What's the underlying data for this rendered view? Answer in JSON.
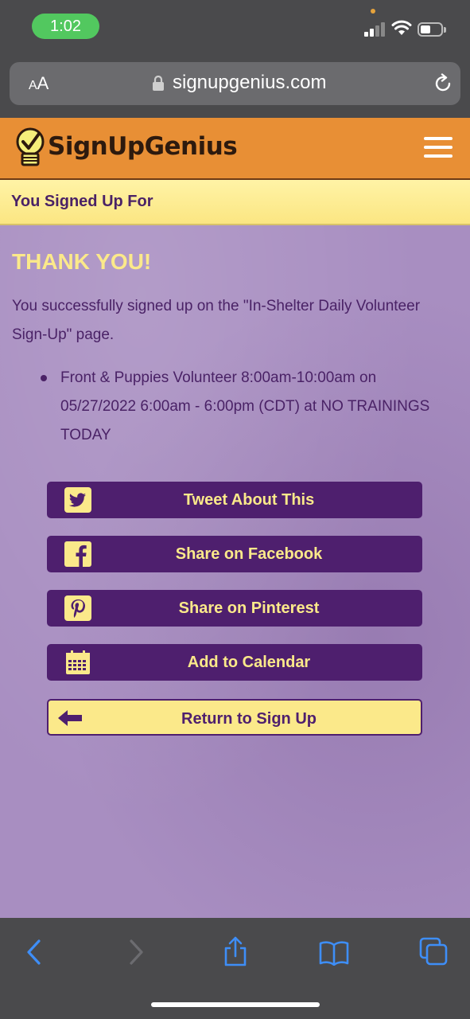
{
  "status_bar": {
    "time": "1:02"
  },
  "browser": {
    "text_size_label_small": "A",
    "text_size_label_large": "A",
    "url": "signupgenius.com"
  },
  "site": {
    "logo_text": "SignUpGenius",
    "section_title": "You Signed Up For"
  },
  "confirmation": {
    "heading": "THANK YOU!",
    "message": "You successfully signed up on the \"In-Shelter Daily Volunteer Sign-Up\" page.",
    "items": [
      "Front & Puppies Volunteer 8:00am-10:00am on 05/27/2022 6:00am - 6:00pm (CDT) at NO TRAININGS TODAY"
    ]
  },
  "actions": {
    "tweet": "Tweet About This",
    "facebook": "Share on Facebook",
    "pinterest": "Share on Pinterest",
    "calendar": "Add to Calendar",
    "return": "Return to Sign Up"
  },
  "colors": {
    "header_orange": "#e88f35",
    "brand_purple": "#4e1f6e",
    "accent_yellow": "#fbe98a",
    "content_bg": "#a88ec1",
    "ios_blue": "#3e8ef7"
  }
}
